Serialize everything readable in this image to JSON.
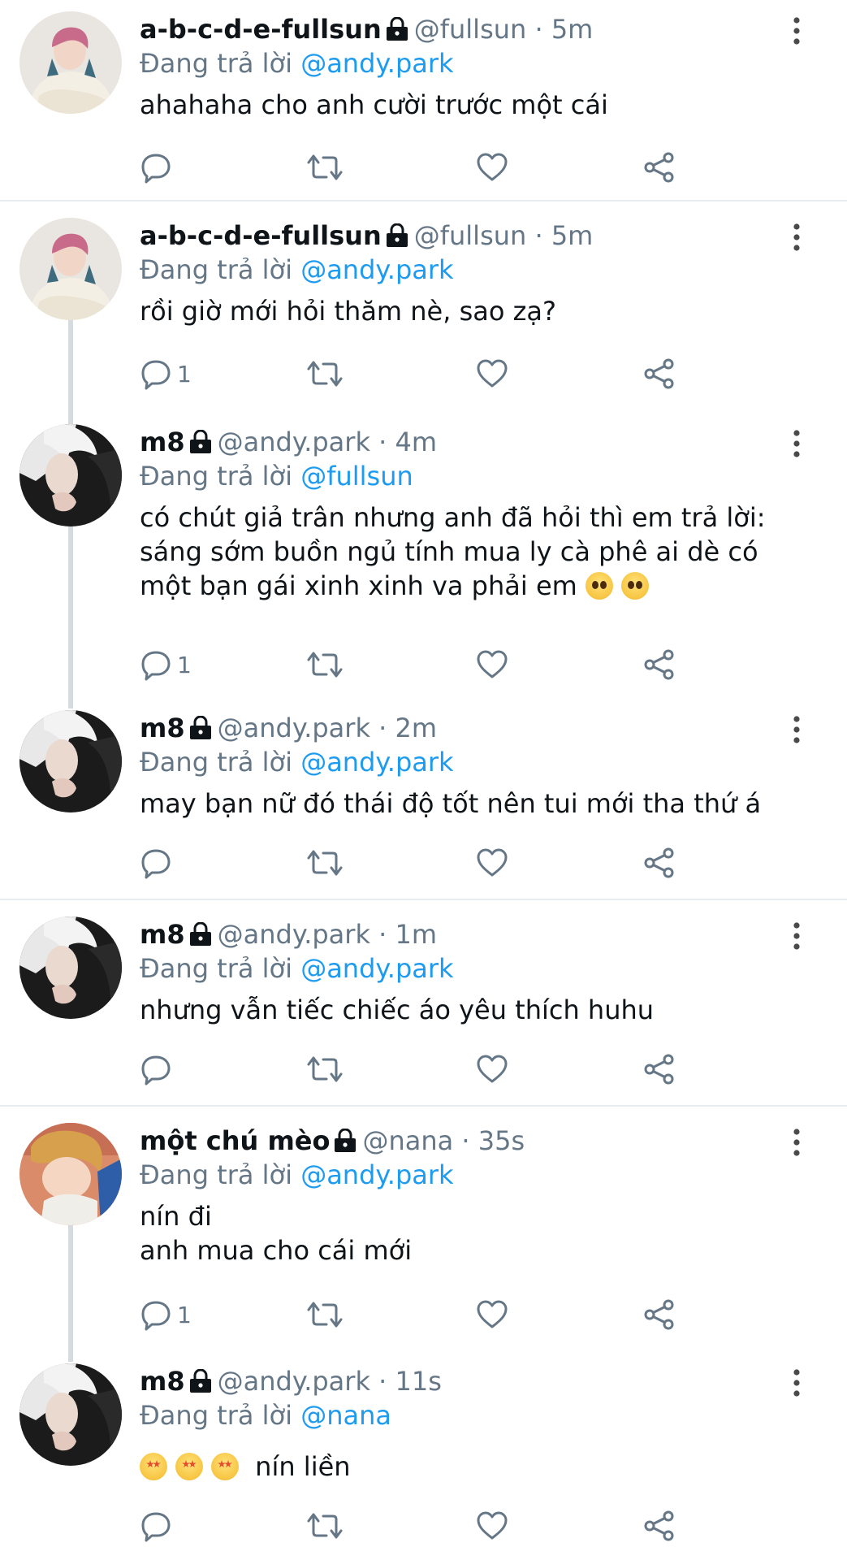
{
  "reply_prefix": "Đang trả lời",
  "tweets": [
    {
      "name": "a-b-c-d-e-fullsun",
      "handle": "@fullsun",
      "dot": "·",
      "time": "5m",
      "reply_to": "@andy.park",
      "text": "ahahaha cho anh cười trước một cái",
      "reply_count": ""
    },
    {
      "name": "a-b-c-d-e-fullsun",
      "handle": "@fullsun",
      "dot": "·",
      "time": "5m",
      "reply_to": "@andy.park",
      "text": "rồi giờ mới hỏi thăm nè, sao zạ?",
      "reply_count": "1"
    },
    {
      "name": "m8",
      "handle": "@andy.park",
      "dot": "·",
      "time": "4m",
      "reply_to": "@fullsun",
      "text": "có chút giả trân nhưng anh đã hỏi thì em trả lời:\nsáng sớm buồn ngủ tính mua ly cà phê ai dè có\nmột bạn gái xinh xinh va phải em",
      "reply_count": "1"
    },
    {
      "name": "m8",
      "handle": "@andy.park",
      "dot": "·",
      "time": "2m",
      "reply_to": "@andy.park",
      "text": "may bạn nữ đó thái độ tốt nên tui mới tha thứ á",
      "reply_count": ""
    },
    {
      "name": "m8",
      "handle": "@andy.park",
      "dot": "·",
      "time": "1m",
      "reply_to": "@andy.park",
      "text": "nhưng vẫn tiếc chiếc áo yêu thích huhu",
      "reply_count": ""
    },
    {
      "name": "một chú mèo",
      "handle": "@nana",
      "dot": "·",
      "time": "35s",
      "reply_to": "@andy.park",
      "text": "nín đi\nanh mua cho cái mới",
      "reply_count": "1"
    },
    {
      "name": "m8",
      "handle": "@andy.park",
      "dot": "·",
      "time": "11s",
      "reply_to": "@nana",
      "text": "nín liền",
      "reply_count": ""
    }
  ],
  "colors": {
    "link": "#1d9bf0",
    "secondary": "#657786",
    "divider": "#e6ecf0",
    "thread_line": "#d6dbe0"
  },
  "icons": [
    "lock-icon",
    "more-icon",
    "reply-icon",
    "retweet-icon",
    "like-icon",
    "share-icon"
  ]
}
